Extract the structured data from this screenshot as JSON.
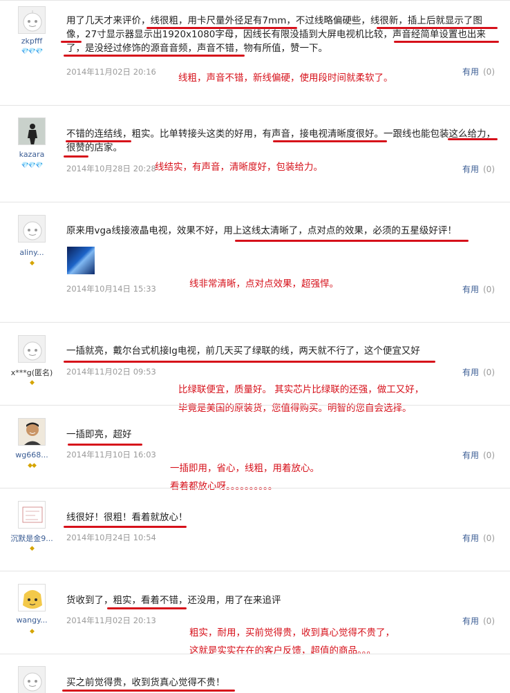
{
  "reviews": [
    {
      "user": "zkpfff",
      "badges": "💎💎💎",
      "text": "用了几天才来评价，线很粗，用卡尺量外径足有7mm，不过线略偏硬些，线很新，插上后就显示了图像，27寸显示器显示出1920x1080字母，因线长有限没插到大屏电视机比较，声音经简单设置也出来了，是没经过修饰的源音音频，声音不错，物有所值，赞一下。",
      "date": "2014年11月02日 20:16",
      "useful_label": "有用",
      "useful_count": "(0)",
      "note": "线粗，声音不错，新线偏硬，使用段时间就柔软了。"
    },
    {
      "user": "kazara",
      "badges": "💎💎💎",
      "text": "不错的连结线，粗实。比单转接头这类的好用，有声音，接电视清晰度很好。一跟线也能包装这么给力，很赞的店家。",
      "date": "2014年10月28日 20:28",
      "useful_label": "有用",
      "useful_count": "(0)",
      "note": "线结实，有声音，清晰度好，包装给力。"
    },
    {
      "user": "aliny...",
      "badges": "◆",
      "text": "原来用vga线接液晶电视，效果不好，用上这线太清晰了，点对点的效果，必须的五星级好评！",
      "date": "2014年10月14日 15:33",
      "useful_label": "有用",
      "useful_count": "(0)",
      "note": "线非常清晰，点对点效果，超强悍。"
    },
    {
      "user": "x***g(匿名)",
      "badges": "◆",
      "text": "一插就亮，戴尔台式机接lg电视，前几天买了绿联的线，两天就不行了，这个便宜又好",
      "date": "2014年11月02日 09:53",
      "useful_label": "有用",
      "useful_count": "(0)",
      "note_line1": "比绿联便宜，质量好。   其实芯片比绿联的还强，做工又好，",
      "note_line2": "毕竟是美国的原装货，您值得购买。明智的您自会选择。"
    },
    {
      "user": "wg668...",
      "badges": "◆◆",
      "text": "一插即亮，超好",
      "date": "2014年11月10日 16:03",
      "useful_label": "有用",
      "useful_count": "(0)",
      "note_line1": "一插即用，省心，线粗，用着放心。",
      "note_line2": "看着都放心呀。。。。。。。。。。"
    },
    {
      "user": "沉默是金9...",
      "badges": "◆",
      "text": "线很好！很粗！看着就放心！",
      "date": "2014年10月24日 10:54",
      "useful_label": "有用",
      "useful_count": "(0)"
    },
    {
      "user": "wangy...",
      "badges": "◆",
      "text": "货收到了，粗实，看着不错，还没用，用了在来追评",
      "date": "2014年11月02日 20:13",
      "useful_label": "有用",
      "useful_count": "(0)",
      "note_line1": "粗实，耐用，买前觉得贵，收到真心觉得不贵了，",
      "note_line2": "这就是实实在在的客户反馈，超值的商品。。。"
    },
    {
      "text": "买之前觉得贵，收到货真心觉得不贵！"
    }
  ],
  "colors": {
    "annotation": "#d6101a",
    "username": "#3b5d94",
    "meta": "#9a9a9a"
  }
}
